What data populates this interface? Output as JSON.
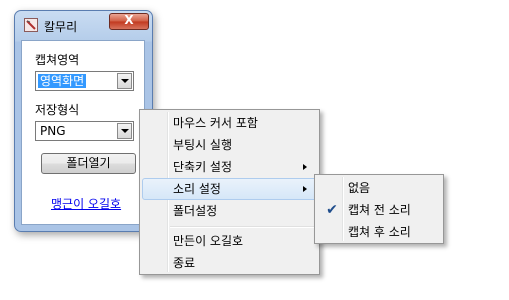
{
  "window": {
    "title": "칼무리",
    "icon": "app-icon",
    "close_label": "X"
  },
  "form": {
    "capture_area_label": "캡쳐영역",
    "capture_area_value": "영역화면",
    "save_format_label": "저장형식",
    "save_format_value": "PNG",
    "open_folder_button": "폴더열기",
    "link_text": "맹근이 오길호"
  },
  "context_menu": {
    "items": [
      {
        "label": "마우스 커서 포함",
        "submenu": false
      },
      {
        "label": "부팅시 실행",
        "submenu": false
      },
      {
        "label": "단축키 설정",
        "submenu": true
      },
      {
        "label": "소리 설정",
        "submenu": true,
        "highlighted": true
      },
      {
        "label": "폴더설정",
        "submenu": false
      },
      {
        "label": "만든이 오길호",
        "submenu": false
      },
      {
        "label": "종료",
        "submenu": false
      }
    ]
  },
  "sound_submenu": {
    "items": [
      {
        "label": "없음",
        "checked": false
      },
      {
        "label": "캡쳐 전 소리",
        "checked": true
      },
      {
        "label": "캡쳐 후 소리",
        "checked": false
      }
    ],
    "check_glyph": "✔"
  },
  "colors": {
    "menu_highlight": "#d6e7f8",
    "selection": "#3399ff",
    "link": "#0000ee",
    "close_button": "#c1381f"
  }
}
